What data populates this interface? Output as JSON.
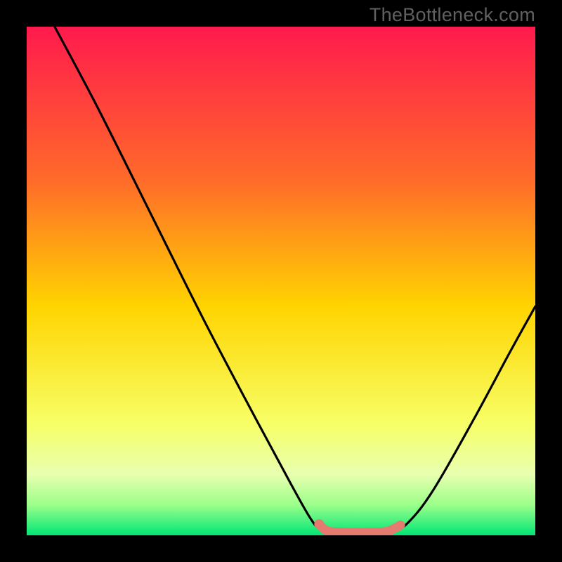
{
  "watermark": "TheBottleneck.com",
  "chart_data": {
    "type": "line",
    "title": "",
    "xlabel": "",
    "ylabel": "",
    "xlim": [
      0,
      100
    ],
    "ylim": [
      0,
      100
    ],
    "gradient_stops": [
      {
        "offset": 0,
        "color": "#ff1a4d"
      },
      {
        "offset": 30,
        "color": "#ff6a2a"
      },
      {
        "offset": 55,
        "color": "#ffd400"
      },
      {
        "offset": 78,
        "color": "#f7ff66"
      },
      {
        "offset": 88,
        "color": "#e8ffb0"
      },
      {
        "offset": 94,
        "color": "#9cff8a"
      },
      {
        "offset": 100,
        "color": "#00e676"
      }
    ],
    "series": [
      {
        "name": "bottleneck-curve",
        "color": "#000000",
        "points": [
          {
            "x": 5.5,
            "y": 100
          },
          {
            "x": 14,
            "y": 84
          },
          {
            "x": 25,
            "y": 62
          },
          {
            "x": 35,
            "y": 42
          },
          {
            "x": 45,
            "y": 23
          },
          {
            "x": 52,
            "y": 10
          },
          {
            "x": 56,
            "y": 3
          },
          {
            "x": 58,
            "y": 1.2
          },
          {
            "x": 62,
            "y": 0.6
          },
          {
            "x": 68,
            "y": 0.6
          },
          {
            "x": 72,
            "y": 0.8
          },
          {
            "x": 75,
            "y": 2.5
          },
          {
            "x": 80,
            "y": 9
          },
          {
            "x": 88,
            "y": 23
          },
          {
            "x": 95,
            "y": 36
          },
          {
            "x": 100,
            "y": 45
          }
        ]
      },
      {
        "name": "highlight-segment",
        "color": "#e47a70",
        "points": [
          {
            "x": 57.5,
            "y": 2.2
          },
          {
            "x": 59,
            "y": 0.9
          },
          {
            "x": 62,
            "y": 0.6
          },
          {
            "x": 68,
            "y": 0.6
          },
          {
            "x": 71,
            "y": 0.8
          },
          {
            "x": 73.5,
            "y": 2.0
          }
        ]
      }
    ],
    "marker": {
      "x": 57.5,
      "y": 2.2,
      "color": "#e47a70"
    }
  }
}
